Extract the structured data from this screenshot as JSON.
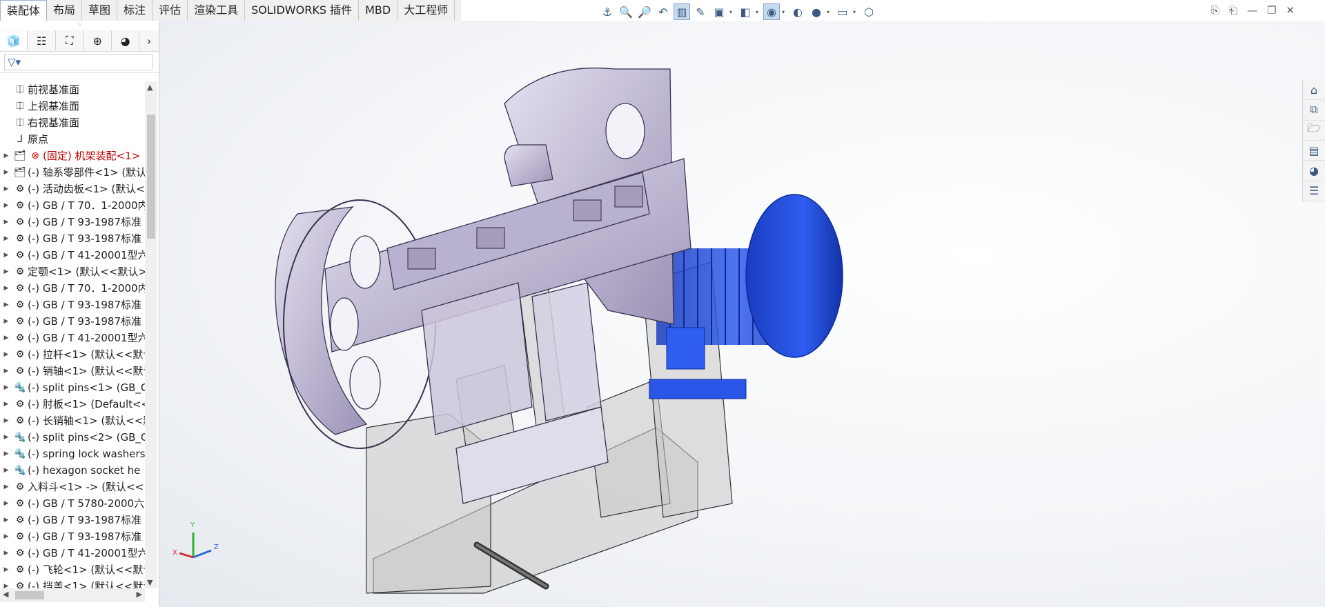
{
  "command_tabs": [
    "装配体",
    "布局",
    "草图",
    "标注",
    "评估",
    "渲染工具",
    "SOLIDWORKS 插件",
    "MBD",
    "大工程师"
  ],
  "hud_icons": [
    "anchor-icon",
    "zoom-fit-icon",
    "zoom-area-icon",
    "previous-view-icon",
    "section-view-icon",
    "dynamic-annotation-icon",
    "view-orientation-icon",
    "display-style-icon",
    "hide-show-icon",
    "appearance-icon",
    "scene-icon",
    "view-settings-icon",
    "cube-icon"
  ],
  "panel_tabs": [
    "featuremanager-icon",
    "propertymanager-icon",
    "configurationmanager-icon",
    "dimxpert-icon",
    "display-manager-icon"
  ],
  "tree": [
    {
      "label": "前视基准面",
      "icon": "plane",
      "expand": false,
      "error": false
    },
    {
      "label": "上视基准面",
      "icon": "plane",
      "expand": false,
      "error": false
    },
    {
      "label": "右视基准面",
      "icon": "plane",
      "expand": false,
      "error": false
    },
    {
      "label": "原点",
      "icon": "origin",
      "expand": false,
      "error": false
    },
    {
      "label": "(固定) 机架装配<1>",
      "icon": "subasm",
      "expand": true,
      "error": true
    },
    {
      "label": "(-) 轴系零部件<1> (默认",
      "icon": "subasm",
      "expand": true,
      "error": false
    },
    {
      "label": "(-) 活动齿板<1> (默认<",
      "icon": "part",
      "expand": true,
      "error": false
    },
    {
      "label": "(-) GB / T 70．1-2000内",
      "icon": "part",
      "expand": true,
      "error": false
    },
    {
      "label": "(-) GB / T 93-1987标准",
      "icon": "part",
      "expand": true,
      "error": false
    },
    {
      "label": "(-) GB / T 93-1987标准",
      "icon": "part",
      "expand": true,
      "error": false
    },
    {
      "label": "(-) GB / T 41-20001型六",
      "icon": "part",
      "expand": true,
      "error": false
    },
    {
      "label": "定颚<1> (默认<<默认>",
      "icon": "part",
      "expand": true,
      "error": false
    },
    {
      "label": "(-) GB / T 70．1-2000内",
      "icon": "part",
      "expand": true,
      "error": false
    },
    {
      "label": "(-) GB / T 93-1987标准",
      "icon": "part",
      "expand": true,
      "error": false
    },
    {
      "label": "(-) GB / T 93-1987标准",
      "icon": "part",
      "expand": true,
      "error": false
    },
    {
      "label": "(-) GB / T 41-20001型六",
      "icon": "part",
      "expand": true,
      "error": false
    },
    {
      "label": "(-) 拉杆<1> (默认<<默认",
      "icon": "part",
      "expand": true,
      "error": false
    },
    {
      "label": "(-) 销轴<1> (默认<<默认",
      "icon": "part",
      "expand": true,
      "error": false
    },
    {
      "label": "(-) split pins<1> (GB_C",
      "icon": "toolbox",
      "expand": true,
      "error": false
    },
    {
      "label": "(-) 肘板<1> (Default<<",
      "icon": "part",
      "expand": true,
      "error": false
    },
    {
      "label": "(-) 长销轴<1> (默认<<默",
      "icon": "part",
      "expand": true,
      "error": false
    },
    {
      "label": "(-) split pins<2> (GB_C",
      "icon": "toolbox",
      "expand": true,
      "error": false
    },
    {
      "label": "(-) spring lock washers",
      "icon": "toolbox",
      "expand": true,
      "error": false
    },
    {
      "label": "(-) hexagon socket he",
      "icon": "toolbox",
      "expand": true,
      "error": false
    },
    {
      "label": "入料斗<1> -> (默认<<",
      "icon": "part",
      "expand": true,
      "error": false
    },
    {
      "label": "(-) GB / T 5780-2000六",
      "icon": "part",
      "expand": true,
      "error": false
    },
    {
      "label": "(-) GB / T 93-1987标准",
      "icon": "part",
      "expand": true,
      "error": false
    },
    {
      "label": "(-) GB / T 93-1987标准",
      "icon": "part",
      "expand": true,
      "error": false
    },
    {
      "label": "(-) GB / T 41-20001型六",
      "icon": "part",
      "expand": true,
      "error": false
    },
    {
      "label": "(-) 飞轮<1> (默认<<默认",
      "icon": "part",
      "expand": true,
      "error": false
    },
    {
      "label": "(-) 挡盖<1> (默认<<默认",
      "icon": "part",
      "expand": true,
      "error": false
    }
  ],
  "triad": {
    "x": "X",
    "y": "Y",
    "z": "Z"
  },
  "task_pane_icons": [
    "home-icon",
    "design-library-icon",
    "file-explorer-icon",
    "view-palette-icon",
    "appearances-icon",
    "custom-properties-icon"
  ]
}
